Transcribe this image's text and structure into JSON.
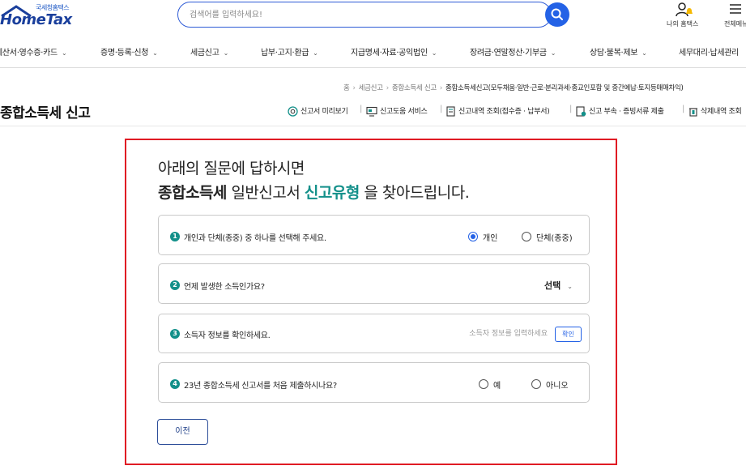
{
  "header": {
    "logo_sub": "국세청홈택스",
    "logo_main": "HomeTax",
    "search_placeholder": "검색어를 입력하세요!",
    "my_hometax_label": "나의 홈택스",
    "all_menu_label": "전체메뉴"
  },
  "nav": {
    "items": [
      {
        "label": "계산서·영수증·카드"
      },
      {
        "label": "증명·등록·신청"
      },
      {
        "label": "세금신고"
      },
      {
        "label": "납부·고지·환급"
      },
      {
        "label": "지급명세·자료·공익법인"
      },
      {
        "label": "장려금·연말정산·기부금"
      },
      {
        "label": "상담·불복·제보"
      },
      {
        "label": "세무대리·납세관리"
      }
    ]
  },
  "breadcrumb": {
    "home": "홈",
    "level1": "세금신고",
    "level2": "종합소득세 신고",
    "current": "종합소득세신고(모두채움·일반·근로·분리과세·종교인포함 및 중간예납·토지등매매차익)"
  },
  "page": {
    "title": "종합소득세 신고",
    "quick_links": [
      {
        "label": "신고서 미리보기",
        "icon": "preview-icon"
      },
      {
        "label": "신고도움 서비스",
        "icon": "monitor-icon"
      },
      {
        "label": "신고내역 조회(접수증 · 납부서)",
        "icon": "document-icon"
      },
      {
        "label": "신고 부속 · 증빙서류 제출",
        "icon": "upload-doc-icon"
      },
      {
        "label": "삭제내역 조회",
        "icon": "trash-icon"
      }
    ]
  },
  "wizard": {
    "intro_line1": "아래의 질문에 답하시면",
    "intro_line2_part1": "종합소득세",
    "intro_line2_part2": " 일반신고서 ",
    "intro_line2_part3": "신고유형",
    "intro_line2_part4": " 을 찾아드립니다.",
    "questions": [
      {
        "num": "1",
        "text": "개인과 단체(종중) 중 하나를 선택해 주세요.",
        "options": [
          {
            "label": "개인",
            "selected": true
          },
          {
            "label": "단체(종중)",
            "selected": false
          }
        ]
      },
      {
        "num": "2",
        "text": "언제 발생한 소득인가요?",
        "select_value": "선택"
      },
      {
        "num": "3",
        "text": "소득자 정보를 확인하세요.",
        "input_placeholder": "소득자 정보를 입력하세요",
        "button_label": "확인"
      },
      {
        "num": "4",
        "text": "23년 종합소득세 신고서를 처음 제출하시나요?",
        "options": [
          {
            "label": "예",
            "selected": false
          },
          {
            "label": "아니오",
            "selected": false
          }
        ]
      }
    ],
    "prev_button": "이전"
  },
  "colors": {
    "accent_blue": "#2462e6",
    "teal": "#13908a",
    "highlight_red": "#e01b24",
    "logo_blue": "#1a3f9c"
  }
}
